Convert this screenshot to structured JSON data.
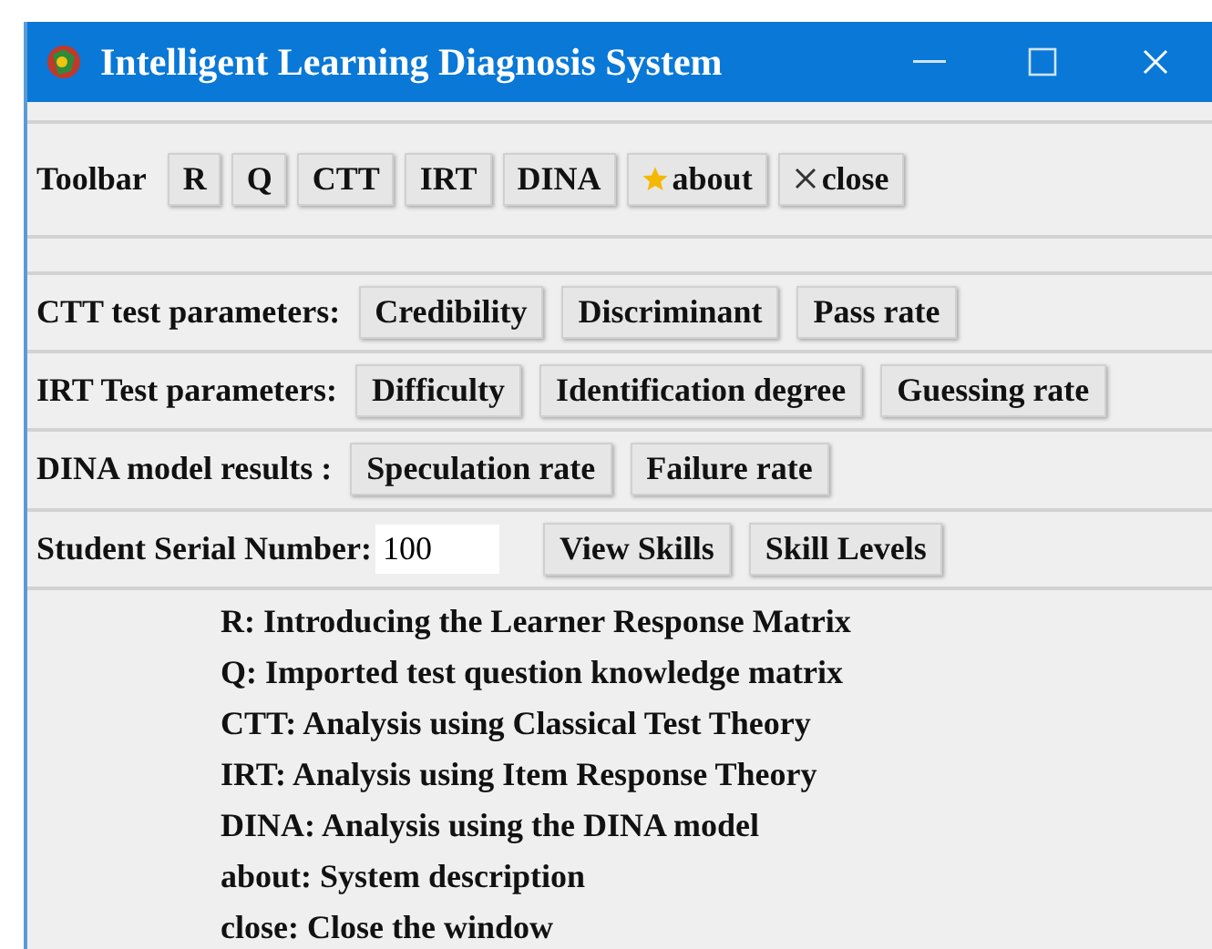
{
  "window": {
    "title": "Intelligent Learning Diagnosis System"
  },
  "toolbar": {
    "label": "Toolbar",
    "buttons": [
      {
        "label": "R",
        "kind": "plain"
      },
      {
        "label": "Q",
        "kind": "plain"
      },
      {
        "label": "CTT",
        "kind": "plain"
      },
      {
        "label": "IRT",
        "kind": "plain"
      },
      {
        "label": "DINA",
        "kind": "plain"
      },
      {
        "label": "about",
        "kind": "star"
      },
      {
        "label": "close",
        "kind": "cross"
      }
    ]
  },
  "parameter_rows": [
    {
      "label": "CTT test parameters:",
      "buttons": [
        "Credibility",
        "Discriminant",
        "Pass rate"
      ]
    },
    {
      "label": "IRT Test parameters:",
      "buttons": [
        "Difficulty",
        "Identification degree",
        "Guessing rate"
      ]
    },
    {
      "label": "DINA model results :",
      "buttons": [
        "Speculation rate",
        "Failure rate"
      ]
    }
  ],
  "student": {
    "label": "Student Serial Number:",
    "value": "100",
    "buttons": [
      "View Skills",
      "Skill Levels"
    ]
  },
  "help_lines": [
    "R: Introducing the Learner Response Matrix",
    "Q: Imported test question knowledge matrix",
    "CTT: Analysis using Classical Test Theory",
    "IRT: Analysis using Item Response Theory",
    "DINA: Analysis using the DINA model",
    "about: System description",
    "close: Close the window"
  ]
}
